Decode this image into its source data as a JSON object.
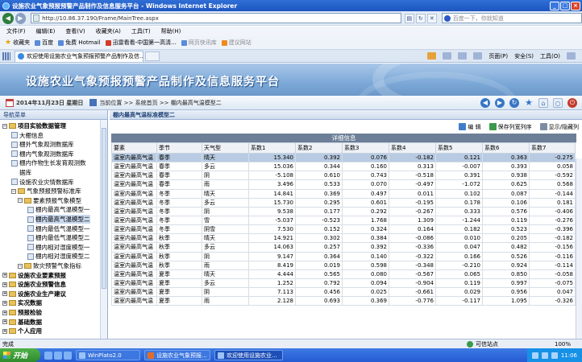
{
  "window": {
    "title": "设施农业气象预报预警产品制作及信息服务平台 - Windows Internet Explorer",
    "buttons": [
      "_",
      "□",
      "×"
    ]
  },
  "addressbar": {
    "url": "http://10.86.37.190/Frame/MainTree.aspx",
    "search_placeholder": "百度一下，你就知道"
  },
  "menubar": [
    "文件(F)",
    "编辑(E)",
    "查看(V)",
    "收藏夹(A)",
    "工具(T)",
    "帮助(H)"
  ],
  "favorites": {
    "label": "收藏夹",
    "items": [
      {
        "label": "百度",
        "icon": "baidu-icon"
      },
      {
        "label": "免费 Hotmail",
        "icon": "hotmail-icon"
      },
      {
        "label": "迅雷看看-中国第一高清...",
        "icon": "xunlei-icon"
      },
      {
        "label": "网页快讯库",
        "icon": "webslice-icon",
        "dim": true
      },
      {
        "label": "建议网站",
        "icon": "suggested-sites-icon",
        "dim": true
      }
    ]
  },
  "tab": {
    "label": "欢迎使用设施农业气象预报预警产品制作及信..."
  },
  "commandbar": [
    "页面(P)",
    "安全(S)",
    "工具(O)"
  ],
  "app": {
    "title": "设施农业气象预报预警产品制作及信息服务平台",
    "date": "2014年11月23日 星期日",
    "location_label": "当前位置",
    "breadcrumb": ">> 系统首页 >> 棚内最高气温模型二"
  },
  "sidebar": {
    "header": "导航菜单",
    "tree": [
      {
        "label": "项目实验数据管理",
        "level": 0,
        "type": "root",
        "bold": true
      },
      {
        "label": "大棚信息",
        "level": 1,
        "type": "leaf"
      },
      {
        "label": "棚外气象观测数据库",
        "level": 1,
        "type": "leaf"
      },
      {
        "label": "棚内气象观测数据库",
        "level": 1,
        "type": "leaf"
      },
      {
        "label": "棚内作物生长发育观测数",
        "level": 1,
        "type": "leaf"
      },
      {
        "label": "据库",
        "level": 1,
        "type": "cont"
      },
      {
        "label": "设施农业灾情数据库",
        "level": 1,
        "type": "leaf"
      },
      {
        "label": "气象预报预警标准库",
        "level": 1,
        "type": "folder"
      },
      {
        "label": "要素预报气象模型",
        "level": 2,
        "type": "folder"
      },
      {
        "label": "棚内最高气温模型一",
        "level": 3,
        "type": "leaf"
      },
      {
        "label": "棚内最高气温模型二",
        "level": 3,
        "type": "leaf",
        "selected": true
      },
      {
        "label": "棚内最低气温模型一",
        "level": 3,
        "type": "leaf"
      },
      {
        "label": "棚内最低气温模型二",
        "level": 3,
        "type": "leaf"
      },
      {
        "label": "棚内相对湿度模型一",
        "level": 3,
        "type": "leaf"
      },
      {
        "label": "棚内相对湿度模型二",
        "level": 3,
        "type": "leaf"
      },
      {
        "label": "致灾预警气象指标",
        "level": 2,
        "type": "folder"
      },
      {
        "label": "设施农业要素预报",
        "level": 0,
        "type": "root",
        "bold": true
      },
      {
        "label": "设施农业预警信息",
        "level": 0,
        "type": "root",
        "bold": true
      },
      {
        "label": "设施农业生产建议",
        "level": 0,
        "type": "root",
        "bold": true
      },
      {
        "label": "实况数据",
        "level": 0,
        "type": "root",
        "bold": true
      },
      {
        "label": "预报检验",
        "level": 0,
        "type": "root",
        "bold": true
      },
      {
        "label": "基础数据",
        "level": 0,
        "type": "root",
        "bold": true
      },
      {
        "label": "个人应用",
        "level": 0,
        "type": "root",
        "bold": true
      }
    ]
  },
  "panel": {
    "title": "棚内最高气温标准模型二",
    "toolbar": {
      "edit": "编 辑",
      "save_order": "保存列宽列序",
      "show_hide": "显示/隐藏列"
    },
    "caption": "详细信息",
    "columns": [
      "要素",
      "季节",
      "天气型",
      "系数1",
      "系数2",
      "系数3",
      "系数4",
      "系数5",
      "系数6",
      "系数7"
    ],
    "rows": [
      [
        "温室内最高气温",
        "春季",
        "晴天",
        "15.340",
        "0.392",
        "0.076",
        "-0.182",
        "0.121",
        "0.363",
        "-0.275"
      ],
      [
        "温室内最高气温",
        "春季",
        "多云",
        "15.036",
        "0.344",
        "0.160",
        "0.313",
        "-0.007",
        "0.393",
        "0.058"
      ],
      [
        "温室内最高气温",
        "春季",
        "阴",
        "-5.108",
        "0.610",
        "0.743",
        "-0.518",
        "0.391",
        "0.938",
        "-0.592"
      ],
      [
        "温室内最高气温",
        "春季",
        "雨",
        "3.496",
        "0.533",
        "0.070",
        "-0.497",
        "-1.072",
        "0.625",
        "0.568"
      ],
      [
        "温室内最高气温",
        "冬季",
        "晴天",
        "14.841",
        "0.369",
        "0.497",
        "0.011",
        "0.102",
        "0.087",
        "-0.144"
      ],
      [
        "温室内最高气温",
        "冬季",
        "多云",
        "15.730",
        "0.295",
        "0.601",
        "-0.195",
        "0.178",
        "0.106",
        "0.181"
      ],
      [
        "温室内最高气温",
        "冬季",
        "阴",
        "9.538",
        "0.177",
        "0.292",
        "-0.267",
        "0.333",
        "0.576",
        "-0.406"
      ],
      [
        "温室内最高气温",
        "冬季",
        "雪",
        "-5.037",
        "-0.523",
        "1.768",
        "1.309",
        "-1.244",
        "0.119",
        "-0.276"
      ],
      [
        "温室内最高气温",
        "冬季",
        "阴雪",
        "7.530",
        "0.152",
        "0.324",
        "0.164",
        "0.182",
        "0.523",
        "-0.396"
      ],
      [
        "温室内最高气温",
        "秋季",
        "晴天",
        "14.921",
        "0.302",
        "0.384",
        "-0.086",
        "0.010",
        "0.205",
        "-0.182"
      ],
      [
        "温室内最高气温",
        "秋季",
        "多云",
        "14.063",
        "0.257",
        "0.392",
        "-0.336",
        "0.047",
        "0.482",
        "-0.156"
      ],
      [
        "温室内最高气温",
        "秋季",
        "阴",
        "9.147",
        "0.364",
        "0.140",
        "-0.322",
        "0.166",
        "0.526",
        "-0.116"
      ],
      [
        "温室内最高气温",
        "秋季",
        "雨",
        "8.419",
        "0.019",
        "0.598",
        "-0.348",
        "-0.210",
        "0.924",
        "-0.114"
      ],
      [
        "温室内最高气温",
        "夏季",
        "晴天",
        "4.444",
        "0.565",
        "0.080",
        "-0.567",
        "0.065",
        "0.850",
        "-0.058"
      ],
      [
        "温室内最高气温",
        "夏季",
        "多云",
        "1.252",
        "0.792",
        "0.094",
        "-0.904",
        "0.119",
        "0.997",
        "-0.075"
      ],
      [
        "温室内最高气温",
        "夏季",
        "阴",
        "7.113",
        "0.456",
        "0.025",
        "-0.661",
        "0.029",
        "0.956",
        "0.047"
      ],
      [
        "温室内最高气温",
        "夏季",
        "雨",
        "2.128",
        "0.693",
        "0.369",
        "-0.776",
        "-0.117",
        "1.095",
        "-0.326"
      ]
    ]
  },
  "statusbar": {
    "left": "完成",
    "zone": "可信站点",
    "zoom": "100%"
  },
  "taskbar": {
    "start": "开始",
    "tasks": [
      "WinPlato2.0",
      "设施农业气象预报...",
      "欢迎使用设施农业..."
    ],
    "clock": "11:06"
  },
  "colors": {
    "titlebar": "#1d55c0",
    "header": "#7da9d8",
    "grid_caption": "#6d7f97",
    "selected_row": "#b8cbe2"
  }
}
